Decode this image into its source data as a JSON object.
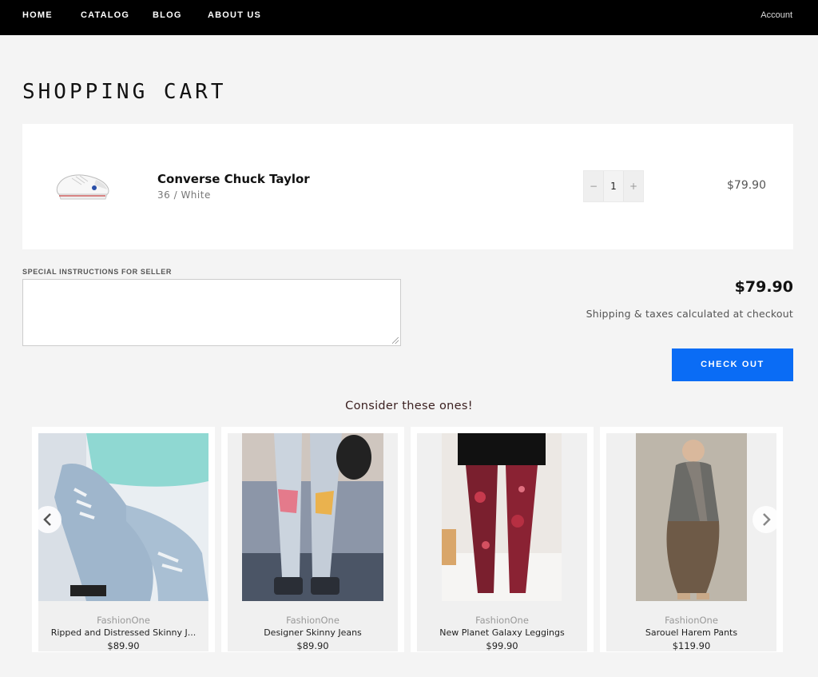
{
  "nav": {
    "items": [
      "HOME",
      "CATALOG",
      "BLOG",
      "ABOUT US"
    ],
    "account": "Account"
  },
  "page": {
    "title": "SHOPPING CART"
  },
  "cart": {
    "item": {
      "title": "Converse Chuck Taylor",
      "variant": "36 / White",
      "quantity": "1",
      "minus": "−",
      "plus": "+",
      "price": "$79.90",
      "image_icon": "white-sneaker-image"
    },
    "instructions_label": "SPECIAL INSTRUCTIONS FOR SELLER",
    "instructions_value": "",
    "subtotal": "$79.90",
    "shipping_note": "Shipping & taxes calculated at checkout",
    "checkout_label": "CHECK OUT"
  },
  "recommendations": {
    "heading": "Consider these ones!",
    "prev_icon": "chevron-left-icon",
    "next_icon": "chevron-right-icon",
    "items": [
      {
        "vendor": "FashionOne",
        "name": "Ripped and Distressed Skinny J...",
        "price": "$89.90"
      },
      {
        "vendor": "FashionOne",
        "name": "Designer Skinny Jeans",
        "price": "$89.90"
      },
      {
        "vendor": "FashionOne",
        "name": "New Planet Galaxy Leggings",
        "price": "$99.90"
      },
      {
        "vendor": "FashionOne",
        "name": "Sarouel Harem Pants",
        "price": "$119.90"
      }
    ]
  },
  "colors": {
    "nav_bg": "#000000",
    "accent": "#0a6cf5",
    "page_bg": "#f4f4f4"
  }
}
